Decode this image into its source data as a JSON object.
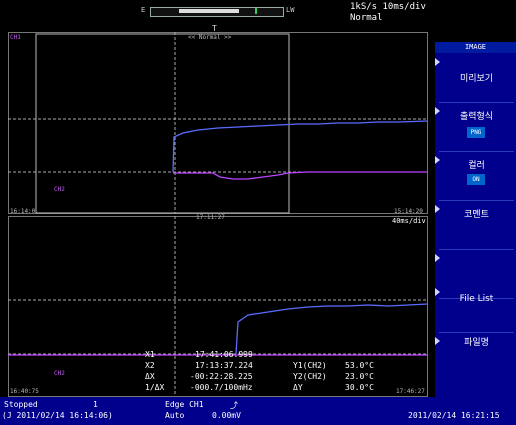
{
  "topbar": {
    "zoom_left_label": "E",
    "zoom_right_label": "LW",
    "sample_rate": "1kS/s 10ms/div",
    "trigger_mode": "Normal"
  },
  "screen": {
    "marker_top": "T",
    "zoom_title": "<< Normal >>",
    "upper_left_time": "16:14:0",
    "upper_right_time": "15:14:20",
    "upper_mid_time": "17:11:27",
    "lower_right_scale": "40ms/div",
    "lower_left_time": "16:40:75",
    "lower_right_time": "17:46:27",
    "ch_label_a": "CH1",
    "ch_label_b": "CH2"
  },
  "readout": {
    "x1_label": "X1",
    "x1_value": "17:41:06.999",
    "x2_label": "X2",
    "x2_value": "17:13:37.224",
    "dx_label": "ΔX",
    "dx_value": "-00:22:28.225",
    "inv_dx_label": "1/ΔX",
    "inv_dx_value": "-000.7/100mHz",
    "y1_label": "Y1(CH2)",
    "y1_value": "53.0°C",
    "y2_label": "Y2(CH2)",
    "y2_value": "23.0°C",
    "dy_label": "ΔY",
    "dy_value": "30.0°C"
  },
  "menu": {
    "title": "IMAGE",
    "items": [
      {
        "label": "미리보기",
        "value": ""
      },
      {
        "label": "출력형식",
        "value": "PNG"
      },
      {
        "label": "컬러",
        "value": "ON"
      },
      {
        "label": "코멘트",
        "value": ""
      },
      {
        "label": "",
        "value": ""
      },
      {
        "label": "File List",
        "value": ""
      },
      {
        "label": "파일명",
        "value": ""
      }
    ]
  },
  "bottombar": {
    "status": "Stopped",
    "count": "1",
    "trigger_type": "Edge CH1",
    "trigger_symbol": "⤴",
    "start_time": "(J 2011/02/14 16:14:06)",
    "auto_label": "Auto",
    "level": "0.00mV",
    "clock": "2011/02/14 16:21:15"
  },
  "colors": {
    "background": "#000000",
    "grid": "#8a8a8a",
    "ch1": "#5a6cff",
    "ch2": "#bb44ff",
    "menu": "#00008c"
  }
}
